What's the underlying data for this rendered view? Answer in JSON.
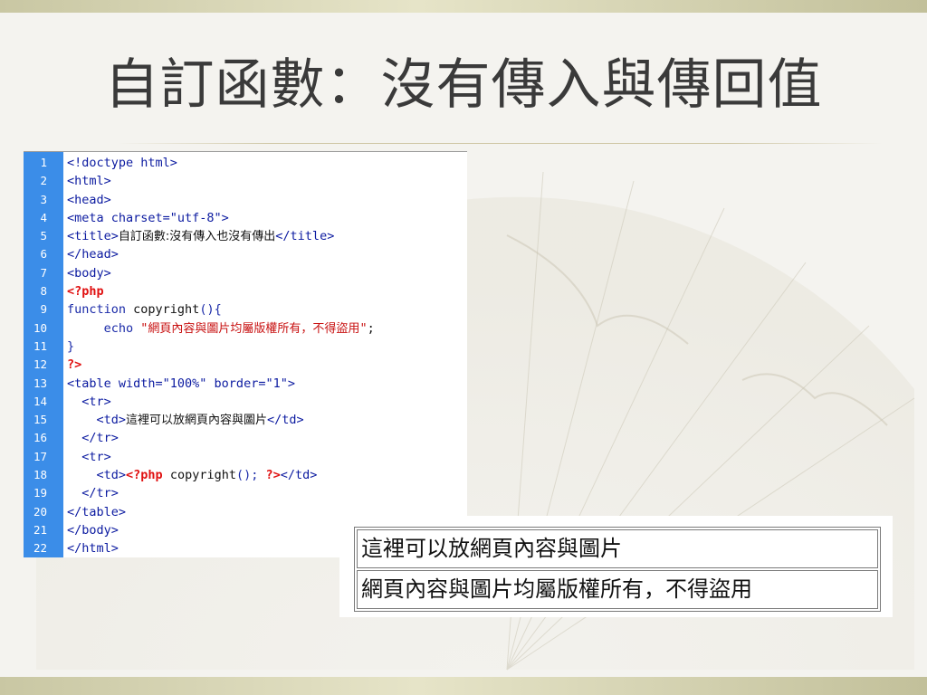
{
  "slide": {
    "title": "自訂函數：沒有傳入與傳回值"
  },
  "code": {
    "lines": [
      {
        "num": "1",
        "parts": [
          {
            "t": "tag",
            "v": "<!doctype html>"
          }
        ]
      },
      {
        "num": "2",
        "parts": [
          {
            "t": "tag",
            "v": "<html>"
          }
        ]
      },
      {
        "num": "3",
        "parts": [
          {
            "t": "tag",
            "v": "<head>"
          }
        ]
      },
      {
        "num": "4",
        "parts": [
          {
            "t": "tag",
            "v": "<meta charset=\"utf-8\">"
          }
        ]
      },
      {
        "num": "5",
        "parts": [
          {
            "t": "tag",
            "v": "<title>"
          },
          {
            "t": "tagtxt",
            "v": "自訂函數:沒有傳入也沒有傳出"
          },
          {
            "t": "tag",
            "v": "</title>"
          }
        ]
      },
      {
        "num": "6",
        "parts": [
          {
            "t": "tag",
            "v": "</head>"
          }
        ]
      },
      {
        "num": "7",
        "parts": [
          {
            "t": "tag",
            "v": "<body>"
          }
        ]
      },
      {
        "num": "8",
        "parts": [
          {
            "t": "php",
            "v": "<?php"
          }
        ]
      },
      {
        "num": "9",
        "parts": [
          {
            "t": "kw",
            "v": "function "
          },
          {
            "t": "plain",
            "v": "copyright"
          },
          {
            "t": "kw",
            "v": "(){"
          }
        ]
      },
      {
        "num": "10",
        "parts": [
          {
            "t": "kw",
            "v": "     echo "
          },
          {
            "t": "strq",
            "v": "\""
          },
          {
            "t": "str",
            "v": "網頁內容與圖片均屬版權所有，不得盜用"
          },
          {
            "t": "strq",
            "v": "\""
          },
          {
            "t": "plain",
            "v": ";"
          }
        ]
      },
      {
        "num": "11",
        "parts": [
          {
            "t": "kw",
            "v": "}"
          }
        ]
      },
      {
        "num": "12",
        "parts": [
          {
            "t": "php",
            "v": "?>"
          }
        ]
      },
      {
        "num": "13",
        "parts": [
          {
            "t": "tag",
            "v": "<table width=\"100%\" border=\"1\">"
          }
        ]
      },
      {
        "num": "14",
        "parts": [
          {
            "t": "tag",
            "v": "  <tr>"
          }
        ]
      },
      {
        "num": "15",
        "parts": [
          {
            "t": "tag",
            "v": "    <td>"
          },
          {
            "t": "tagtxt",
            "v": "這裡可以放網頁內容與圖片"
          },
          {
            "t": "tag",
            "v": "</td>"
          }
        ]
      },
      {
        "num": "16",
        "parts": [
          {
            "t": "tag",
            "v": "  </tr>"
          }
        ]
      },
      {
        "num": "17",
        "parts": [
          {
            "t": "tag",
            "v": "  <tr>"
          }
        ]
      },
      {
        "num": "18",
        "parts": [
          {
            "t": "tag",
            "v": "    <td>"
          },
          {
            "t": "php",
            "v": "<?php "
          },
          {
            "t": "plain",
            "v": "copyright"
          },
          {
            "t": "kw",
            "v": "(); "
          },
          {
            "t": "php",
            "v": "?>"
          },
          {
            "t": "tag",
            "v": "</td>"
          }
        ]
      },
      {
        "num": "19",
        "parts": [
          {
            "t": "tag",
            "v": "  </tr>"
          }
        ]
      },
      {
        "num": "20",
        "parts": [
          {
            "t": "tag",
            "v": "</table>"
          }
        ]
      },
      {
        "num": "21",
        "parts": [
          {
            "t": "tag",
            "v": "</body>"
          }
        ]
      },
      {
        "num": "22",
        "parts": [
          {
            "t": "tag",
            "v": "</html>"
          }
        ]
      }
    ]
  },
  "output": {
    "rows": [
      "這裡可以放網頁內容與圖片",
      "網頁內容與圖片均屬版權所有，不得盜用"
    ]
  },
  "colors": {
    "gutter": "#3b8de8",
    "tag": "#0b1aa0",
    "php": "#e01010",
    "string": "#c81010",
    "band": "#d8d6b6"
  }
}
